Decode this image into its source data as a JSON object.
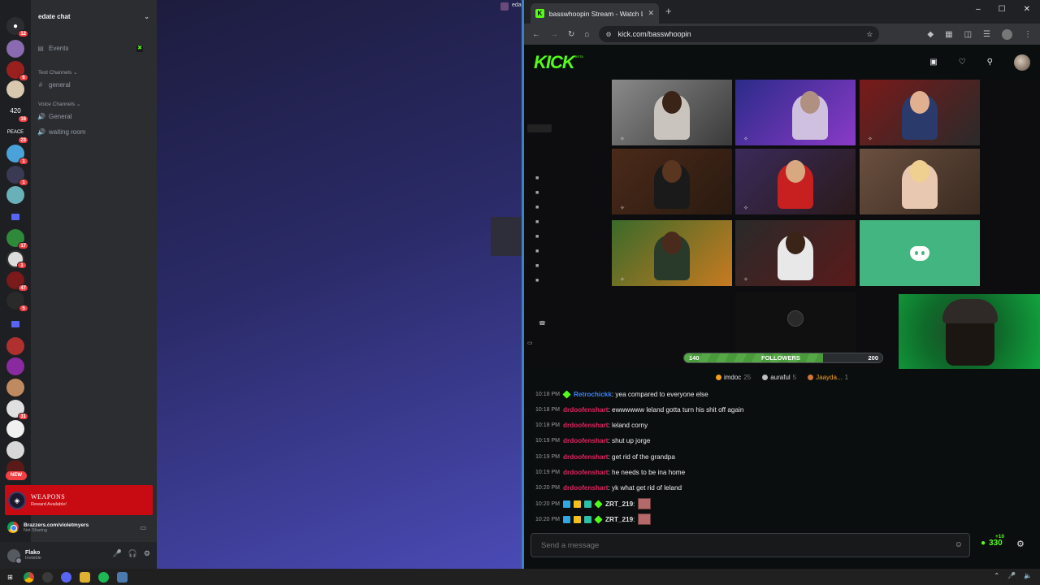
{
  "discord": {
    "server_badges": [
      "12",
      "6",
      "16",
      "23",
      "1",
      "1",
      "17",
      "1",
      "47",
      "5",
      "31"
    ],
    "new_label": "NEW",
    "guild_name": "edate chat",
    "events_label": "Events",
    "text_category": "Text Channels",
    "voice_category": "Voice Channels",
    "channels": {
      "general_text": "general",
      "general_voice": "General",
      "waiting_room": "waiting room"
    },
    "reward": {
      "title": "WEAPONS",
      "subtitle": "Reward Available!"
    },
    "activity": {
      "title": "Brazzers.com/violetmyers",
      "subtitle": "Not Sharing"
    },
    "user": {
      "name": "Flako",
      "status": "Invisible"
    },
    "top_right_user": "eda"
  },
  "chrome": {
    "tab_title": "basswhoopin Stream - Watch L",
    "url": "kick.com/basswhoopin"
  },
  "kick": {
    "logo": "KICK",
    "beta": "BETA",
    "followers": {
      "current": "140",
      "label": "FOLLOWERS",
      "goal": "200",
      "progress": 0.7
    },
    "leaderboard": [
      {
        "name": "imdoc",
        "count": "25",
        "color": "#f0a020",
        "name_color": "#e0e0e0"
      },
      {
        "name": "auraful",
        "count": "5",
        "color": "#c0c0c0",
        "name_color": "#e0e0e0"
      },
      {
        "name": "Jaayda...",
        "count": "1",
        "color": "#d0763a",
        "name_color": "#f0a020"
      }
    ],
    "chat": [
      {
        "time": "10:18 PM",
        "user": "Retrochickk",
        "user_color": "#3b82f6",
        "text": ": yea compared to everyone else",
        "badges": [
          "#53fc18"
        ]
      },
      {
        "time": "10:18 PM",
        "user": "drdoofenshart",
        "user_color": "#e0245e",
        "text": ": ewwwwww leland gotta turn his shit off again",
        "badges": []
      },
      {
        "time": "10:18 PM",
        "user": "drdoofenshart",
        "user_color": "#e0245e",
        "text": ": leland corny",
        "badges": []
      },
      {
        "time": "10:19 PM",
        "user": "drdoofenshart",
        "user_color": "#e0245e",
        "text": ": shut up jorge",
        "badges": []
      },
      {
        "time": "10:19 PM",
        "user": "drdoofenshart",
        "user_color": "#e0245e",
        "text": ": get rid of the grandpa",
        "badges": []
      },
      {
        "time": "10:19 PM",
        "user": "drdoofenshart",
        "user_color": "#e0245e",
        "text": ": he needs to be ina home",
        "badges": []
      },
      {
        "time": "10:20 PM",
        "user": "drdoofenshart",
        "user_color": "#e0245e",
        "text": ": yk what get rid of leland",
        "badges": []
      },
      {
        "time": "10:20 PM",
        "user": "ZRT_219",
        "user_color": "#e0e0e0",
        "text": ":",
        "badges": [
          "#2ea8e6",
          "#f0c020",
          "#2ebfa5",
          "#53fc18"
        ],
        "emote": true
      },
      {
        "time": "10:20 PM",
        "user": "ZRT_219",
        "user_color": "#e0e0e0",
        "text": ":",
        "badges": [
          "#2ea8e6",
          "#f0c020",
          "#2ebfa5",
          "#53fc18"
        ],
        "emote": true
      }
    ],
    "input_placeholder": "Send a message",
    "points": "330",
    "points_plus": "+10"
  },
  "colors": {
    "kick_green": "#53fc18",
    "discord_blurple": "#5865f2",
    "reward_red": "#c80b12"
  }
}
